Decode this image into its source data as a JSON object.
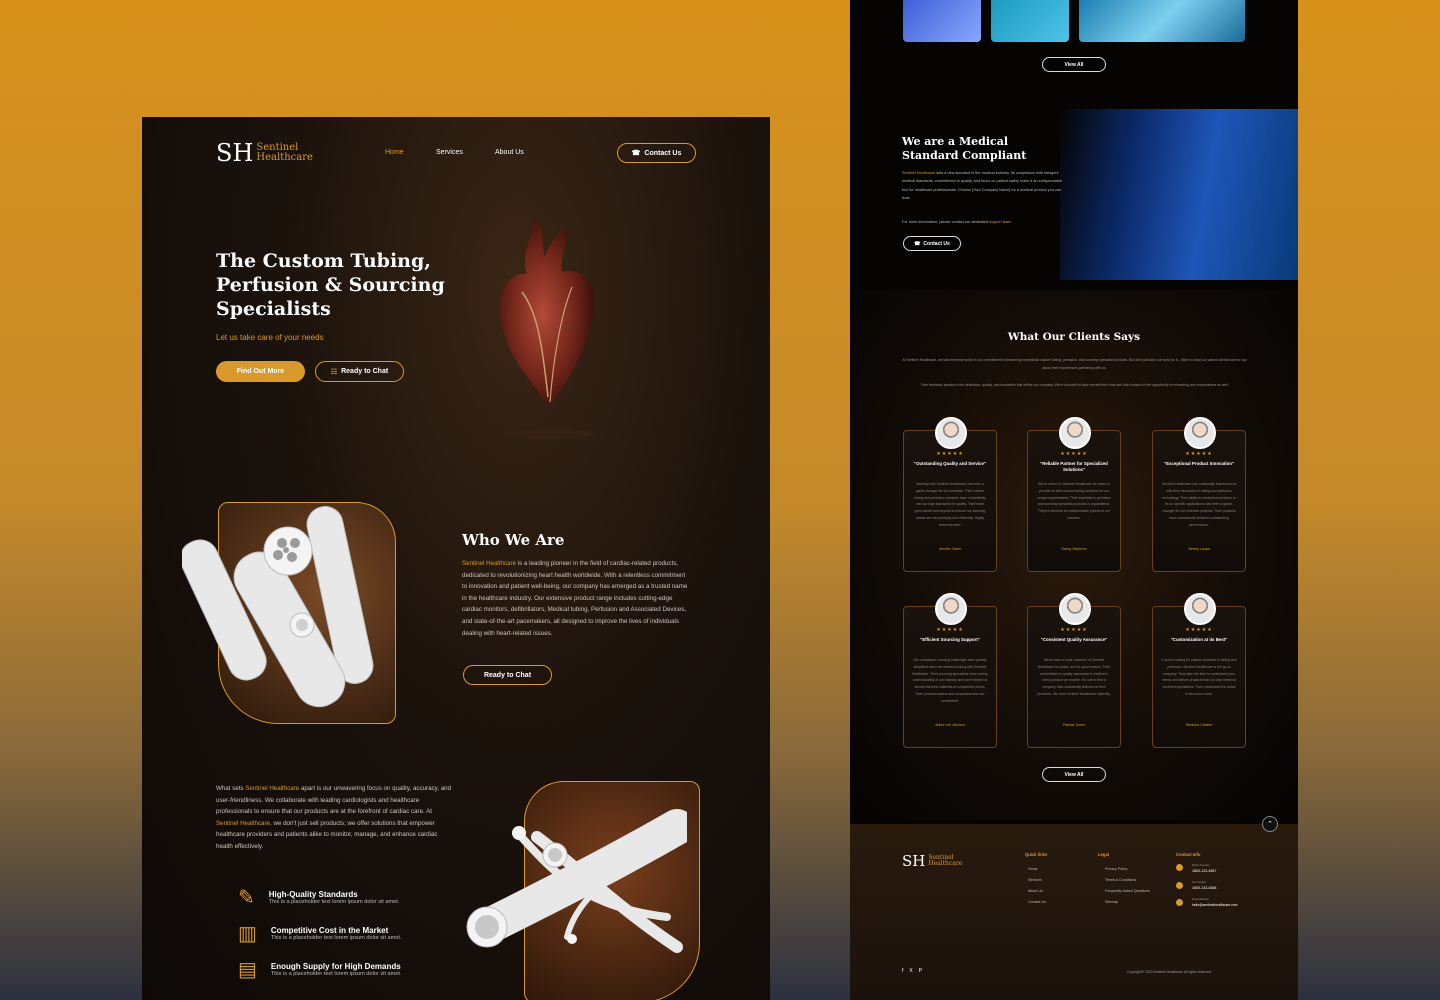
{
  "brand": {
    "initials": "SH",
    "line1": "Sentinel",
    "line2": "Healthcare"
  },
  "nav": {
    "home": "Home",
    "services": "Services",
    "about": "About Us",
    "contact": "Contact Us"
  },
  "hero": {
    "title_l1": "The Custom Tubing,",
    "title_l2": "Perfusion & Sourcing",
    "title_l3": "Specialists",
    "tagline": "Let us take care of your needs",
    "btn_find": "Find Out More",
    "btn_chat": "Ready to Chat"
  },
  "who": {
    "title": "Who We Are",
    "brand_inline": "Sentinel Healthcare",
    "body": " is a leading pioneer in the field of cardiac-related products, dedicated to revolutionizing heart health worldwide. With a relentless commitment to innovation and patient well-being, our company has emerged as a trusted name in the healthcare industry. Our extensive product range includes cutting-edge cardiac monitors, defibrillators, Medical tubing, Perfusion and Associated Devices, and state-of-the-art pacemakers, all designed to improve the lives of individuals dealing with heart-related issues.",
    "btn": "Ready to Chat"
  },
  "sets": {
    "pre": "What sets ",
    "brand": "Sentinel Healthcare",
    "mid": " apart is our unwavering focus on quality, accuracy, and user-friendliness. We collaborate with leading cardiologists and healthcare professionals to ensure that our products are at the forefront of cardiac care. At ",
    "brand2": "Sentinel Healthcare,",
    "post": " we don't just sell products; we offer solutions that empower healthcare providers and patients alike to monitor, manage, and enhance cardiac health effectively."
  },
  "features": [
    {
      "title": "High-Quality Standards",
      "desc": "This is a placeholder text lorem ipsum dolor sit amet."
    },
    {
      "title": "Competitive Cost in the Market",
      "desc": "This is a placeholder text lorem ipsum dolor sit amet."
    },
    {
      "title": "Enough Supply for High Demands",
      "desc": "This is a placeholder text lorem ipsum dolor sit amet."
    }
  ],
  "gallery": {
    "view_all": "View All"
  },
  "compliance": {
    "title_l1": "We are a Medical",
    "title_l2": "Standard Compliant",
    "brand": "Sentinel Healthcare",
    "body": " sets a new standard in the medical industry. Its compliance with stringent medical standards, commitment to quality, and focus on patient safety make it an indispensable tool for healthcare professionals. Choose [Your Company Name] for a medical product you can trust.",
    "more_pre": "For more information, please contact our dedicated ",
    "more_link": "support team.",
    "btn": "Contact Us"
  },
  "testimonials": {
    "title": "What Our Clients Says",
    "intro1": "At Sentinel Healthcare, we take immense pride in our commitment to delivering exceptional custom tubing, perfusion, and sourcing specialist products. But don't just take our word for it – listen to what our valued clients have to say about their experiences partnering with us.",
    "intro2": "Their feedback speaks to the dedication, quality, and innovation that define our company. We're honored to have earned their trust and look forward to the opportunity of exceeding your expectations as well.",
    "stars": "★★★★★",
    "cards": [
      {
        "title": "\"Outstanding Quality and Service\"",
        "body": "Working with Sentinel Healthcare has been a game-changer for our business. Their custom tubing and perfusion products have consistently met our high standards for quality. Their team goes above and beyond to ensure our sourcing needs are met promptly and efficiently. Highly recommended.",
        "name": "Jennifer Carter"
      },
      {
        "title": "\"Reliable Partner for Specialized Solutions\"",
        "body": "We've relied on Sentinel Healthcare for years to provide us with custom tubing solutions for our unique requirements. Their expertise in perfusion and sourcing specialist products is unparalleled. They've become an indispensable partner in our success.",
        "name": "Danny Stephens"
      },
      {
        "title": "\"Exceptional Product Innovation\"",
        "body": "Sentinel Healthcare has continually impressed us with their innovation in tubing and perfusion technology. Their ability to customize solutions to fit our specific applications has been a game-changer for our research projects. Their products have consistently delivered outstanding performance.",
        "name": "Jeremy Lamps"
      },
      {
        "title": "\"Efficient Sourcing Support\"",
        "body": "Our company's sourcing challenges were greatly simplified when we started working with Sentinel Healthcare. Their sourcing specialists have a deep understanding of our industry and have helped us secure the best materials at competitive prices. Their professionalism and responsiveness are unmatched.",
        "name": "Arthur Lee Johnson"
      },
      {
        "title": "\"Consistent Quality Assurance\"",
        "body": "We've been a loyal customer of Sentinel Healthcare for years, and for good reason. Their commitment to quality assurance is evident in every product we receive. It's rare to find a company that consistently delivers on their promises. We trust Sentinel Healthcare implicitly.",
        "name": "Patricia Turner"
      },
      {
        "title": "\"Customization at its Best\"",
        "body": "If you're looking for custom solutions in tubing and perfusion, Sentinel Healthcare is the go-to company. They take the time to understand your needs and deliver products that not only meet but exceed expectations. Their commitment to detail is second to none.",
        "name": "Rebecca Collister"
      }
    ],
    "view_all": "View All"
  },
  "footer": {
    "quick_title": "Quick links",
    "quick": [
      "Home",
      "Services",
      "About Us",
      "Contact Us"
    ],
    "legal_title": "Legal",
    "legal": [
      "Privacy Policy",
      "Terms & Conditions",
      "Frequently Asked Questions",
      "Sitemap"
    ],
    "contact_title": "Contact Info",
    "contact": [
      {
        "label": "Phone Number",
        "value": "1800-123-4567"
      },
      {
        "label": "Fax Number",
        "value": "1800-123-4568"
      },
      {
        "label": "Email Address",
        "value": "hello@sentinelhealthcare.com"
      }
    ],
    "copyright": "Copyright© 2020 Sentinel Healthcare All rights reserved",
    "social": [
      "f",
      "X",
      "P"
    ]
  },
  "colors": {
    "gold": "#d99a2b",
    "dark": "#0d0907"
  }
}
